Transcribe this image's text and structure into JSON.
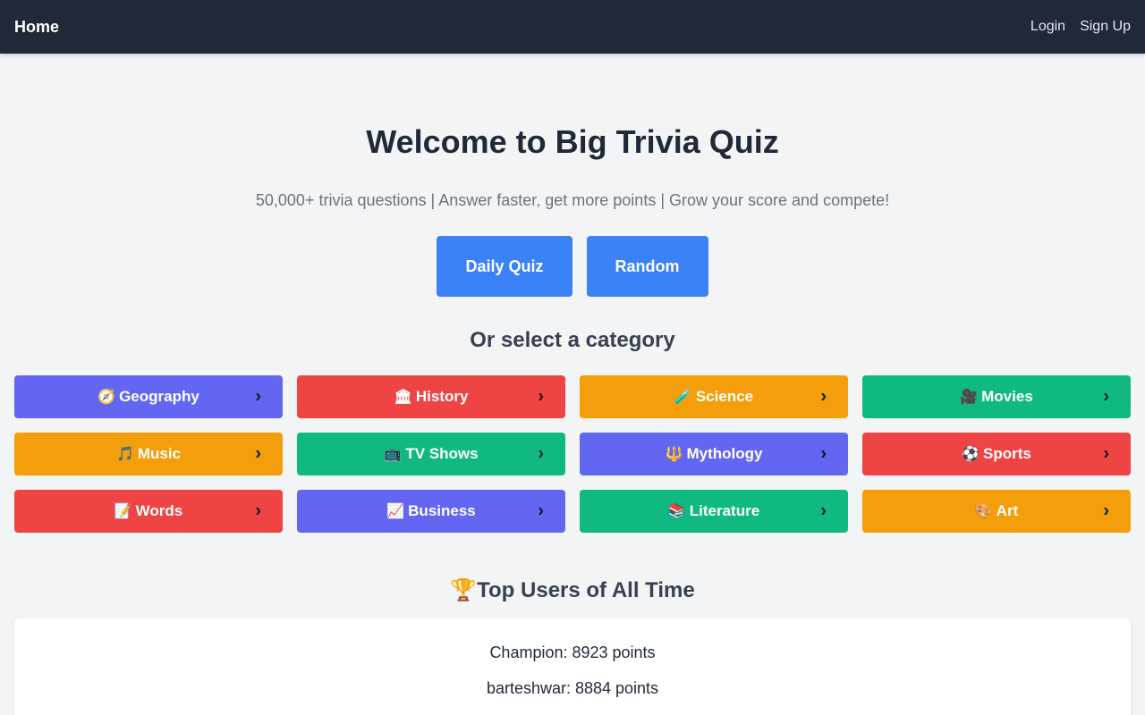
{
  "nav": {
    "home": "Home",
    "login": "Login",
    "signup": "Sign Up"
  },
  "hero": {
    "title": "Welcome to Big Trivia Quiz",
    "subtitle": "50,000+ trivia questions | Answer faster, get more points | Grow your score and compete!",
    "daily_quiz": "Daily Quiz",
    "random": "Random"
  },
  "category_heading": "Or select a category",
  "categories": [
    {
      "icon": "🧭",
      "label": "Geography",
      "color": "#6366f1"
    },
    {
      "icon": "🏛",
      "label": "History",
      "color": "#ef4444"
    },
    {
      "icon": "🧪",
      "label": "Science",
      "color": "#f59e0b"
    },
    {
      "icon": "🎥",
      "label": "Movies",
      "color": "#10b981"
    },
    {
      "icon": "🎵",
      "label": "Music",
      "color": "#f59e0b"
    },
    {
      "icon": "📺",
      "label": "TV Shows",
      "color": "#10b981"
    },
    {
      "icon": "🔱",
      "label": "Mythology",
      "color": "#6366f1"
    },
    {
      "icon": "⚽",
      "label": "Sports",
      "color": "#ef4444"
    },
    {
      "icon": "📝",
      "label": "Words",
      "color": "#ef4444"
    },
    {
      "icon": "📈",
      "label": "Business",
      "color": "#6366f1"
    },
    {
      "icon": "📚",
      "label": "Literature",
      "color": "#10b981"
    },
    {
      "icon": "🎨",
      "label": "Art",
      "color": "#f59e0b"
    }
  ],
  "chevron": "›",
  "top_users": {
    "trophy": "🏆",
    "heading": "Top Users of All Time",
    "entries": [
      "Champion: 8923 points",
      "barteshwar: 8884 points"
    ]
  },
  "colors": {
    "navbar": "#1f2937",
    "primary": "#3b82f6",
    "background": "#f3f4f6"
  }
}
